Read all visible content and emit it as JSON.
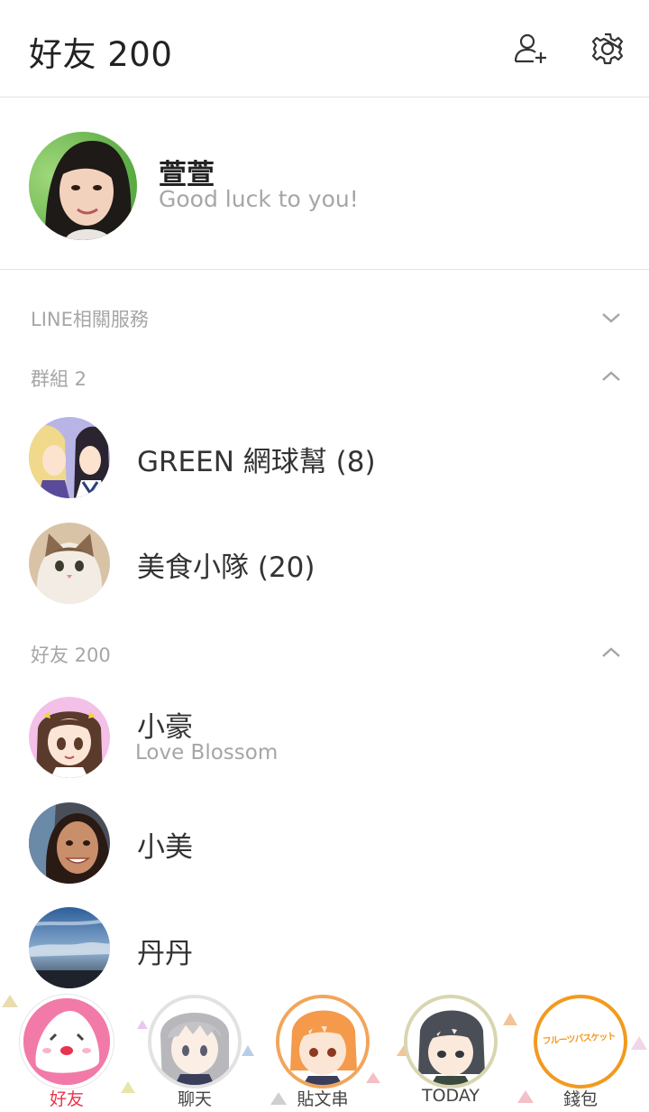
{
  "header": {
    "title": "好友 200",
    "add_friend_icon": "add-friend-icon",
    "settings_icon": "gear-icon"
  },
  "profile": {
    "name": "萱萱",
    "status": "Good luck to you!"
  },
  "sections": {
    "services": {
      "label": "LINE相關服務",
      "state": "collapsed"
    },
    "groups": {
      "label": "群組 2",
      "state": "expanded"
    },
    "friends": {
      "label": "好友 200",
      "state": "expanded"
    }
  },
  "groups": [
    {
      "name": "GREEN 網球幫 (8)"
    },
    {
      "name": "美食小隊 (20)"
    }
  ],
  "friends": [
    {
      "name": "小豪",
      "status": "Love Blossom"
    },
    {
      "name": "小美"
    },
    {
      "name": "丹丹"
    }
  ],
  "tabs": [
    {
      "label": "好友",
      "active": true,
      "color": "#e8344e"
    },
    {
      "label": "聊天"
    },
    {
      "label": "貼文串"
    },
    {
      "label": "TODAY"
    },
    {
      "label": "錢包",
      "logo_text": "フルーツバスケット"
    }
  ],
  "colors": {
    "accent": "#e8344e",
    "divider": "#e3e3e3",
    "muted": "#a6a6a6"
  }
}
